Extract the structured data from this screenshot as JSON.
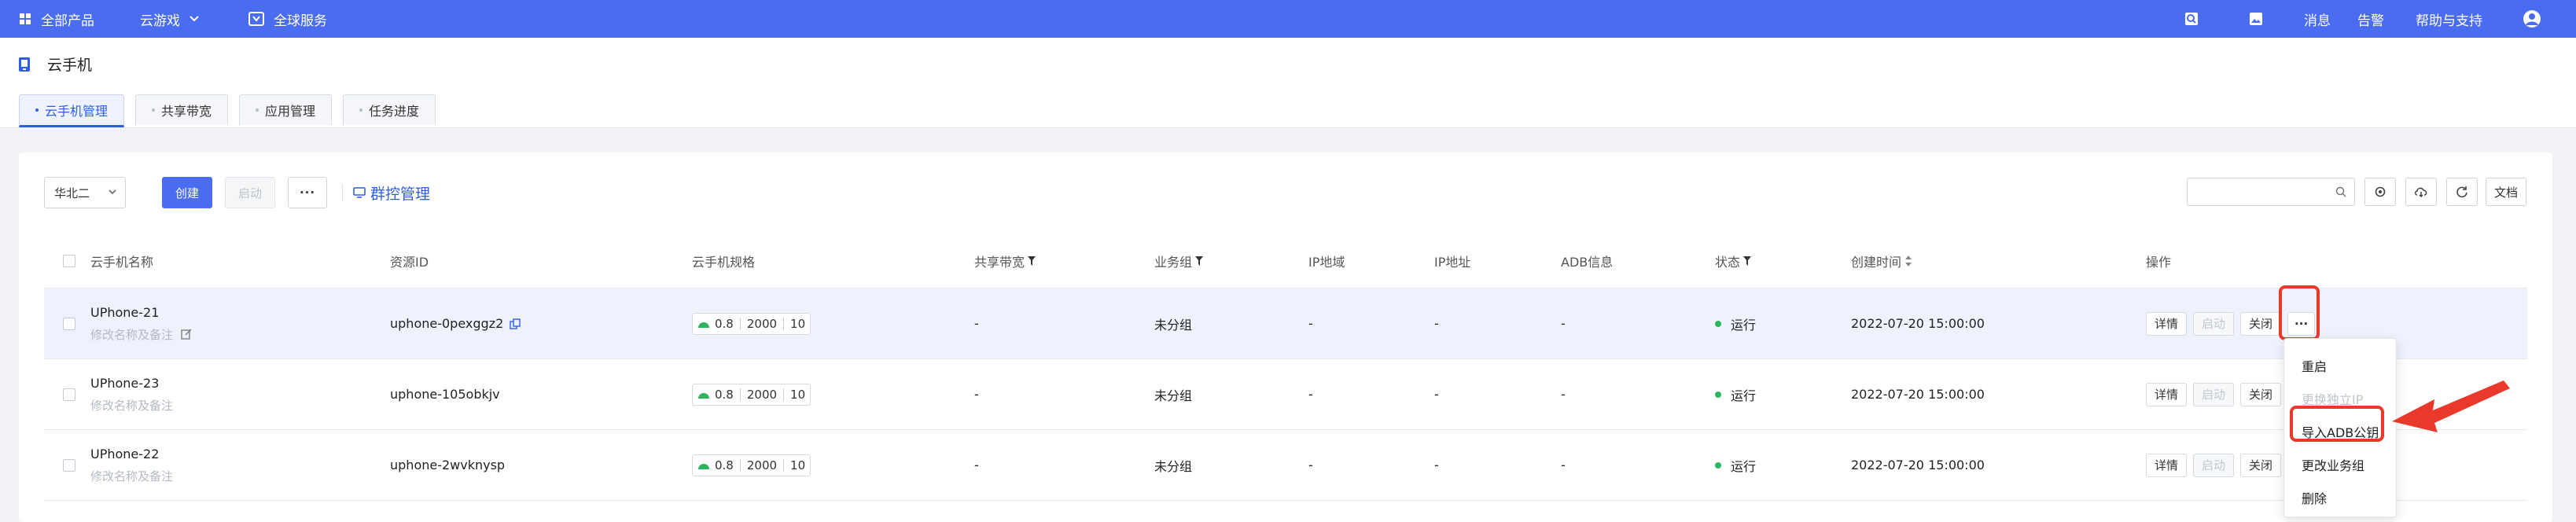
{
  "topbar": {
    "all_products": "全部产品",
    "cloud_game": "云游戏",
    "global_service": "全球服务",
    "messages": "消息",
    "alerts": "告警",
    "help": "帮助与支持"
  },
  "page": {
    "title": "云手机",
    "tabs": [
      {
        "label": "云手机管理",
        "active": true
      },
      {
        "label": "共享带宽",
        "active": false
      },
      {
        "label": "应用管理",
        "active": false
      },
      {
        "label": "任务进度",
        "active": false
      }
    ]
  },
  "toolbar": {
    "region": "华北二",
    "create": "创建",
    "start": "启动",
    "more": "···",
    "group_control": "群控管理",
    "search_placeholder": "",
    "docs": "文档"
  },
  "table": {
    "columns": {
      "name": "云手机名称",
      "resource_id": "资源ID",
      "spec": "云手机规格",
      "bandwidth": "共享带宽",
      "group": "业务组",
      "ip_region": "IP地域",
      "ip_address": "IP地址",
      "adb": "ADB信息",
      "status": "状态",
      "created": "创建时间",
      "actions": "操作"
    },
    "rows": [
      {
        "name": "UPhone-21",
        "remark": "修改名称及备注",
        "resource_id": "uphone-0pexggz2",
        "spec_cpu": "0.8",
        "spec_mem": "2000",
        "spec_disk": "10",
        "bandwidth": "-",
        "group": "未分组",
        "ip_region": "-",
        "ip_address": "-",
        "adb": "-",
        "status": "运行",
        "created": "2022-07-20 15:00:00"
      },
      {
        "name": "UPhone-23",
        "remark": "修改名称及备注",
        "resource_id": "uphone-105obkjv",
        "spec_cpu": "0.8",
        "spec_mem": "2000",
        "spec_disk": "10",
        "bandwidth": "-",
        "group": "未分组",
        "ip_region": "-",
        "ip_address": "-",
        "adb": "-",
        "status": "运行",
        "created": "2022-07-20 15:00:00"
      },
      {
        "name": "UPhone-22",
        "remark": "修改名称及备注",
        "resource_id": "uphone-2wvknysp",
        "spec_cpu": "0.8",
        "spec_mem": "2000",
        "spec_disk": "10",
        "bandwidth": "-",
        "group": "未分组",
        "ip_region": "-",
        "ip_address": "-",
        "adb": "-",
        "status": "运行",
        "created": "2022-07-20 15:00:00"
      }
    ],
    "actions": {
      "details": "详情",
      "start": "启动",
      "stop": "关闭",
      "more": "···"
    }
  },
  "dropdown": {
    "items": [
      {
        "label": "重启",
        "disabled": false
      },
      {
        "label": "更换独立IP",
        "disabled": true
      },
      {
        "label": "导入ADB公钥",
        "disabled": false
      },
      {
        "label": "更改业务组",
        "disabled": false
      },
      {
        "label": "删除",
        "disabled": false
      }
    ]
  },
  "colors": {
    "topbar": "#4a6cf0",
    "primary": "#2f5ee6",
    "status_running": "#2db55d",
    "highlight": "#e8392b"
  }
}
